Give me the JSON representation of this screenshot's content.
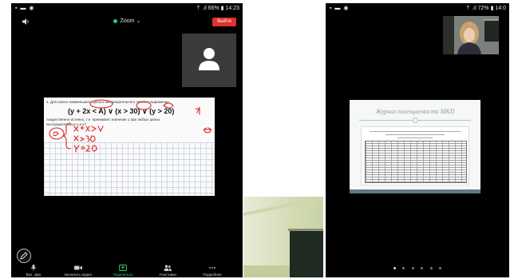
{
  "left_phone": {
    "status": {
      "left_icons": "▪ ▬ ◉",
      "right": "⇡ .ıl 66% ▮ 14:23"
    },
    "meeting": {
      "title": "Zoom",
      "leave_label": "Выйти"
    },
    "whiteboard": {
      "task_line1": "1. Для какого наименьшего целого неотрицательного числа А выражение",
      "formula": "(y + 2x < A) ∨ (x > 30) ∨ (y > 20)",
      "task_line2": "тождественно истинно, т.е. принимает значение 1 при любых целых",
      "task_line3": "неотрицательных x и y?"
    },
    "toolbar": [
      {
        "label": "Вкл. звук",
        "icon": "microphone-icon",
        "active": false
      },
      {
        "label": "Включить видео",
        "icon": "video-camera-icon",
        "active": false
      },
      {
        "label": "Поделиться",
        "icon": "share-icon",
        "active": true
      },
      {
        "label": "Участники",
        "icon": "participants-icon",
        "active": false
      },
      {
        "label": "Подробнее",
        "icon": "more-icon",
        "active": false
      }
    ],
    "colors": {
      "leave": "#e0312b",
      "active": "#2ecc71",
      "ink": "#e02020"
    }
  },
  "right_phone": {
    "status": {
      "left_icons": "▪ ▬ ◉",
      "right": "⇡ .ıl 72% ▮ 14:0"
    },
    "slide": {
      "title": "Журнал посещаемости МКП"
    }
  }
}
